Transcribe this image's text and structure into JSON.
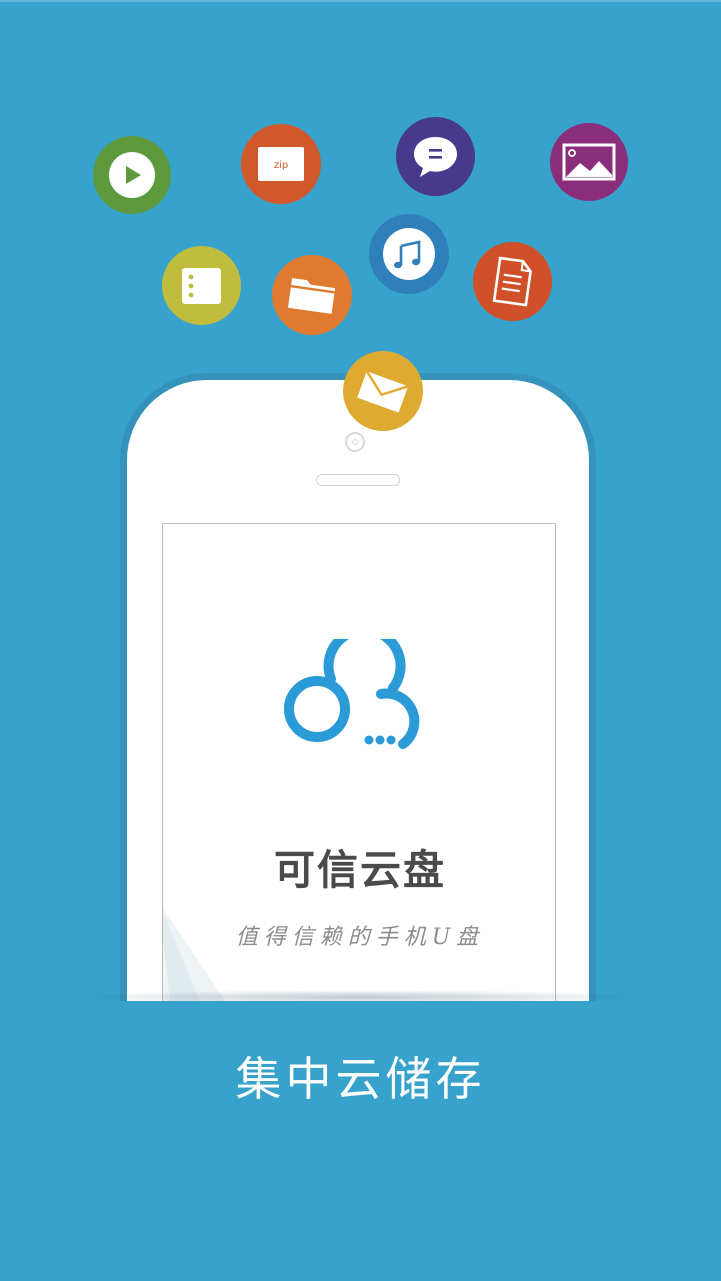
{
  "app": {
    "name": "可信云盘",
    "slogan": "值得信赖的手机U盘"
  },
  "feature": {
    "title": "集中云储存"
  },
  "file_types": [
    {
      "icon": "video-play-icon",
      "color": "#5c9a3d"
    },
    {
      "icon": "zip-archive-icon",
      "color": "#d1582b",
      "label": "zip"
    },
    {
      "icon": "chat-message-icon",
      "color": "#473a8c"
    },
    {
      "icon": "image-icon",
      "color": "#8a2e7c"
    },
    {
      "icon": "list-document-icon",
      "color": "#c0bd3e"
    },
    {
      "icon": "folder-icon",
      "color": "#e07a30"
    },
    {
      "icon": "music-note-icon",
      "color": "#2f80ba"
    },
    {
      "icon": "text-file-icon",
      "color": "#d0502a"
    },
    {
      "icon": "mail-envelope-icon",
      "color": "#deab30"
    }
  ],
  "colors": {
    "background": "#37a3cc",
    "logo_blue": "#2b9bd7",
    "title_gray": "#4a4a4a"
  }
}
